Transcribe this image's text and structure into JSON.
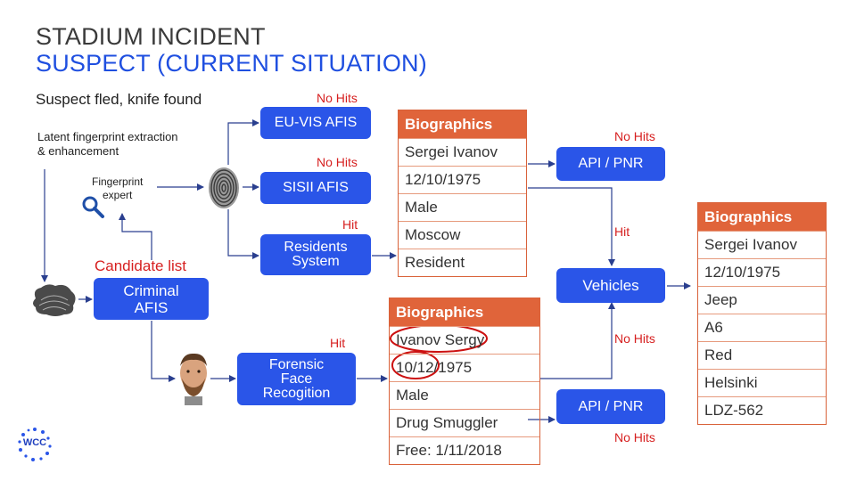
{
  "title": {
    "line1": "STADIUM INCIDENT",
    "line2": "SUSPECT (CURRENT SITUATION)"
  },
  "notes": {
    "fled": "Suspect fled, knife found",
    "latent_line1": "Latent fingerprint extraction",
    "latent_line2": "& enhancement",
    "expert_line1": "Fingerprint",
    "expert_line2": "expert",
    "candidate_list": "Candidate list"
  },
  "boxes": {
    "euvis": "EU-VIS AFIS",
    "sisii": "SISII AFIS",
    "residents_line1": "Residents",
    "residents_line2": "System",
    "criminal_line1": "Criminal",
    "criminal_line2": "AFIS",
    "forensic_line1": "Forensic",
    "forensic_line2": "Face",
    "forensic_line3": "Recogition",
    "api_pnr_top": "API / PNR",
    "api_pnr_bottom": "API / PNR",
    "vehicles": "Vehicles"
  },
  "hit_labels": {
    "euvis": "No Hits",
    "sisii": "No Hits",
    "residents": "Hit",
    "api_top": "No Hits",
    "vehicles_hit": "Hit",
    "forensic": "Hit",
    "vehicles_nohit": "No Hits",
    "api_bottom": "No Hits"
  },
  "tables": {
    "residents": {
      "header": "Biographics",
      "rows": [
        "Sergei Ivanov",
        "12/10/1975",
        "Male",
        "Moscow",
        "Resident"
      ]
    },
    "forensic": {
      "header": "Biographics",
      "rows": [
        "Ivanov Sergy",
        "10/12/1975",
        "Male",
        "Drug Smuggler",
        "Free: 1/11/2018"
      ]
    },
    "result": {
      "header": "Biographics",
      "rows": [
        "Sergei Ivanov",
        "12/10/1975",
        "Jeep",
        "A6",
        "Red",
        "Helsinki",
        "LDZ-562"
      ]
    }
  },
  "logo": {
    "text": "WCC"
  },
  "colors": {
    "accent_blue": "#2a55e8",
    "table_orange": "#e0643a",
    "hit_red": "#d61f1f"
  },
  "icons": [
    "magnifier-icon",
    "fingerprint-icon",
    "latent-print-icon",
    "face-photo-icon",
    "wcc-logo"
  ]
}
